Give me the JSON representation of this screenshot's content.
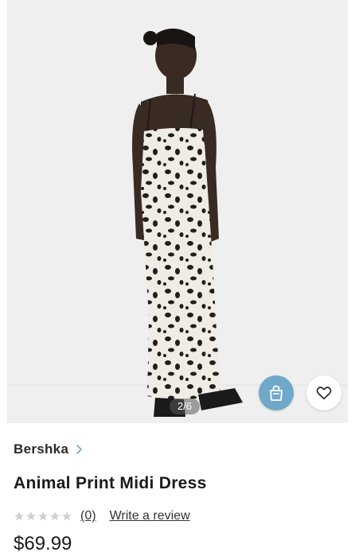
{
  "gallery": {
    "counter": "2/6"
  },
  "product": {
    "brand": "Bershka",
    "title": "Animal Print Midi Dress",
    "rating_value": 0,
    "review_count": "(0)",
    "write_review": "Write a review",
    "price": "$69.99"
  },
  "colors": {
    "accent_bag_button": "#6fa8c9",
    "star_empty": "#d0d0d0"
  },
  "icons": {
    "bag": "shopping-bag-icon",
    "favorite": "heart-icon",
    "brand_link": "chevron-right-icon"
  }
}
